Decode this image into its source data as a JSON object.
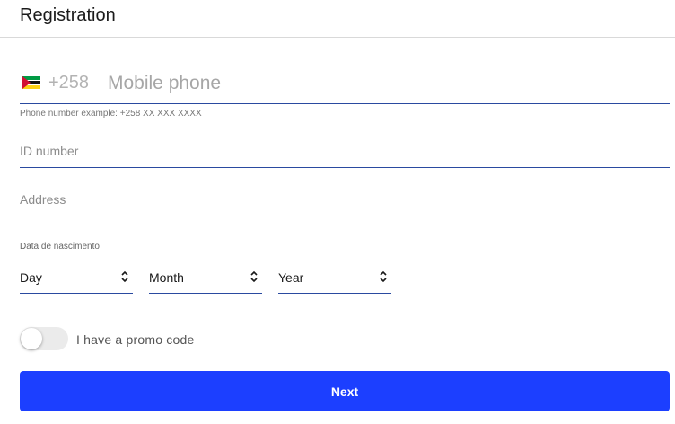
{
  "header": {
    "title": "Registration"
  },
  "phone": {
    "country_flag": "mozambique-flag-icon",
    "dial_code": "+258",
    "placeholder": "Mobile phone",
    "value": "",
    "hint": "Phone number example: +258 XX XXX XXXX"
  },
  "id_number": {
    "placeholder": "ID number",
    "value": ""
  },
  "address": {
    "placeholder": "Address",
    "value": ""
  },
  "birth_date": {
    "label": "Data de nascimento",
    "day": "Day",
    "month": "Month",
    "year": "Year"
  },
  "promo": {
    "label": "I have a promo code",
    "enabled": false
  },
  "actions": {
    "next_label": "Next"
  },
  "colors": {
    "primary": "#1c3fff",
    "underline": "#2a4aa0",
    "toggle_off": "#ebebeb"
  }
}
